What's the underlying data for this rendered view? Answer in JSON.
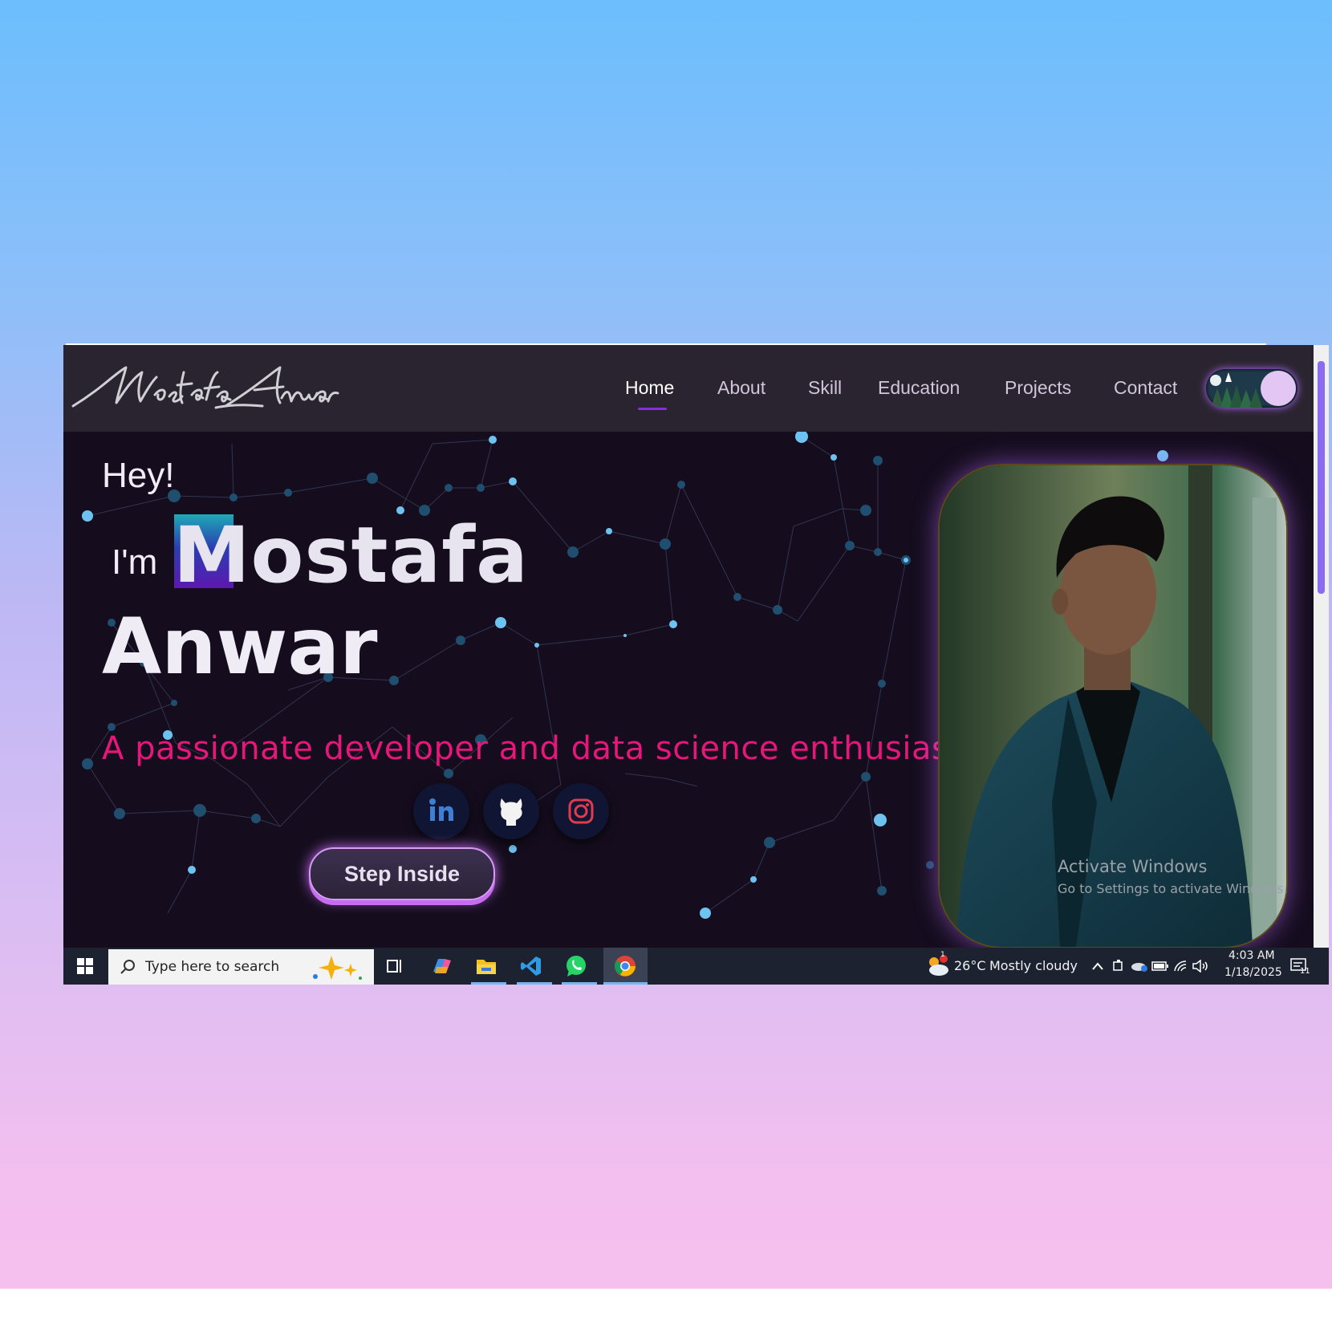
{
  "site": {
    "logo_text": "Mostafa Anwar",
    "nav": [
      {
        "label": "Home",
        "active": true
      },
      {
        "label": "About"
      },
      {
        "label": "Skill"
      },
      {
        "label": "Education"
      },
      {
        "label": "Projects"
      },
      {
        "label": "Contact"
      }
    ],
    "theme_toggle": {
      "state": "dark"
    }
  },
  "hero": {
    "greeting": "Hey!",
    "intro": "I'm",
    "first_name": "Mostafa",
    "last_name": "Anwar",
    "tagline": "A passionate developer and  data  science enthusiast",
    "socials": [
      {
        "name": "linkedin-icon"
      },
      {
        "name": "github-icon"
      },
      {
        "name": "instagram-icon"
      }
    ],
    "cta": "Step Inside",
    "accent_pink": "#e5177a",
    "accent_purple": "#c96ef7"
  },
  "watermark": {
    "title": "Activate Windows",
    "subtitle": "Go to Settings to activate Windows."
  },
  "taskbar": {
    "search_placeholder": "Type here to search",
    "weather": {
      "temp": "26°C",
      "condition": "Mostly cloudy",
      "badge": "1"
    },
    "time": "4:03 AM",
    "date": "1/18/2025",
    "notifications": "11"
  }
}
